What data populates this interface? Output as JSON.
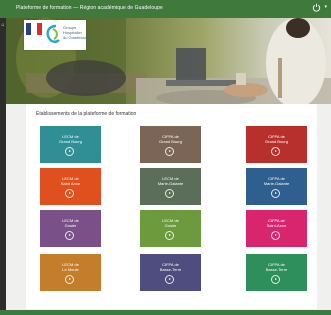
{
  "topbar": {
    "title": "Plateforme de formation — Région académique de Guadeloupe",
    "power_icon": "power-icon"
  },
  "logo": {
    "line1": "Groupe",
    "line2": "Hospitalier",
    "line3": "du Guadeloupe"
  },
  "main": {
    "section_title": "Établissements de la plateforme de formation"
  },
  "tiles": [
    {
      "l1": "LECM de",
      "l2": "Grand Bourg",
      "color": "#2f8f95"
    },
    {
      "l1": "CIFPA de",
      "l2": "Grand Bourg",
      "color": "#7b6556"
    },
    {
      "l1": "CIFPA de",
      "l2": "Grand Bourg",
      "color": "#b8302c"
    },
    {
      "l1": "LECM de",
      "l2": "Saint Anne",
      "color": "#e04f1e"
    },
    {
      "l1": "LECM de",
      "l2": "Marie-Galante",
      "color": "#5b6e5a"
    },
    {
      "l1": "CIFPA de",
      "l2": "Marie-Galante",
      "color": "#2f5f8e"
    },
    {
      "l1": "LECM de",
      "l2": "Gosier",
      "color": "#7a5088"
    },
    {
      "l1": "LECM de",
      "l2": "Gosier",
      "color": "#6c9a3c"
    },
    {
      "l1": "CIFPA de",
      "l2": "Saint-Anne",
      "color": "#d8256d"
    },
    {
      "l1": "LECM de",
      "l2": "Le Moule",
      "color": "#c47d2a"
    },
    {
      "l1": "CIFPA de",
      "l2": "Basse-Terre",
      "color": "#4f4c7e"
    },
    {
      "l1": "CIFPA de",
      "l2": "Basse-Terre",
      "color": "#2f8f5c"
    }
  ]
}
